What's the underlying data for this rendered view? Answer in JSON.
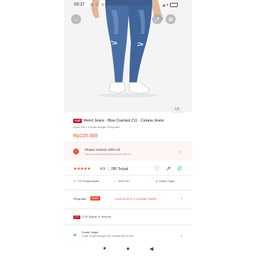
{
  "status_bar": {
    "time": "09:37",
    "left_icons": "◎ ☐ ⊙ ✉",
    "right_icons": "◢ ✦"
  },
  "gallery": {
    "counter": "1/5",
    "back_icon": "arrow-left-icon",
    "share_icon": "share-icon",
    "cart_icon": "cart-icon",
    "image_desc": "model-wearing-blue-skinny-jeans-and-white-sneakers"
  },
  "product": {
    "mall_tag": "Mall",
    "title": "Weird Jeans - Blue Cracked Z11 - Celana Jeans",
    "installment": "Rp44.135 x 6 bulan dengan SPayLater",
    "price": "Rp225.000"
  },
  "guarantee": {
    "title": "Shopee Garansi 100% Ori",
    "subtitle": "Garansi uang kembali jika produk tidak ori"
  },
  "rating": {
    "stars": "★★★★★",
    "score": "4.9",
    "sold": "280 Terjual",
    "wishlist_icon": "heart-icon",
    "share_icon": "share-icon",
    "whatsapp_icon": "whatsapp-icon"
  },
  "badges": [
    {
      "label": "7 Hr Pengembalian"
    },
    {
      "label": "100% Ori"
    },
    {
      "label": "Gratis Ongkir"
    }
  ],
  "spaylater": {
    "label": "SPayLater",
    "tag": "BARU",
    "desc": "Limit s/d 50JT & Voucher 250RB"
  },
  "cod": {
    "tag": "COD",
    "label": "COD (Bayar di Tempat)"
  },
  "shipping": {
    "title": "Gratis Ongkir",
    "subtitle": "Gratis Ongkir dengan min. belanja Rp120.000"
  },
  "navbar": {
    "recent": "■",
    "home": "●",
    "back": "◀"
  },
  "colors": {
    "accent": "#ee4d2d",
    "mall": "#d0011b",
    "shipping": "#00bfa5"
  }
}
